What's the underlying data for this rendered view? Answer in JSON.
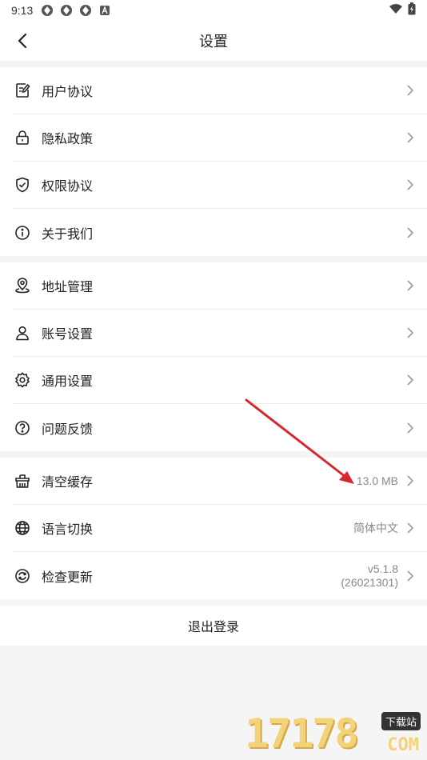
{
  "status_bar": {
    "time": "9:13"
  },
  "header": {
    "title": "设置"
  },
  "groups": [
    [
      {
        "label": "用户协议",
        "icon": "document-edit-icon"
      },
      {
        "label": "隐私政策",
        "icon": "lock-icon"
      },
      {
        "label": "权限协议",
        "icon": "shield-check-icon"
      },
      {
        "label": "关于我们",
        "icon": "info-icon"
      }
    ],
    [
      {
        "label": "地址管理",
        "icon": "location-pin-icon"
      },
      {
        "label": "账号设置",
        "icon": "user-icon"
      },
      {
        "label": "通用设置",
        "icon": "gear-icon"
      },
      {
        "label": "问题反馈",
        "icon": "question-icon"
      }
    ],
    [
      {
        "label": "清空缓存",
        "icon": "broom-icon",
        "value": "13.0 MB"
      },
      {
        "label": "语言切换",
        "icon": "globe-icon",
        "value": "简体中文"
      },
      {
        "label": "检查更新",
        "icon": "refresh-icon",
        "value_line1": "v5.1.8",
        "value_line2": "(26021301)"
      }
    ]
  ],
  "logout": {
    "label": "退出登录"
  },
  "watermark": {
    "digits": "17178",
    "tag": "下载站",
    "domain": "COM"
  },
  "colors": {
    "annotation_arrow": "#d9262b",
    "watermark": "#f3d37a"
  }
}
